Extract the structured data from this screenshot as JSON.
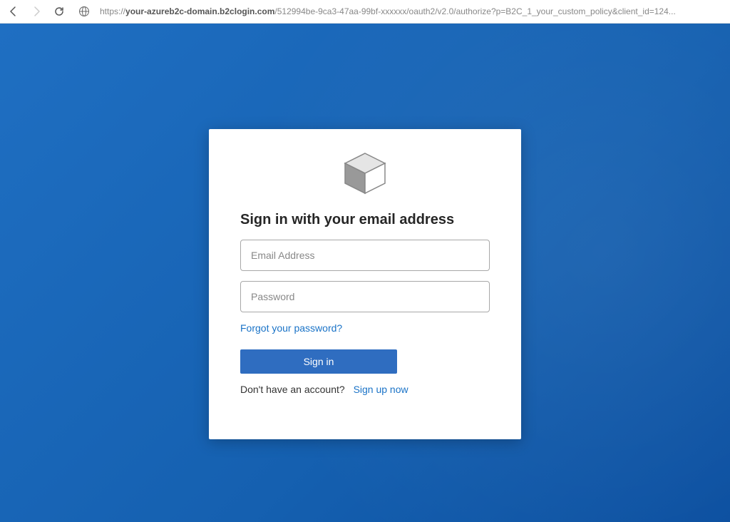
{
  "browser": {
    "url_prefix": "https://",
    "url_domain": "your-azureb2c-domain.b2clogin.com",
    "url_path": "/512994be-9ca3-47aa-99bf-xxxxxx/oauth2/v2.0/authorize?p=B2C_1_your_custom_policy&client_id=124..."
  },
  "card": {
    "title": "Sign in with your email address",
    "email_placeholder": "Email Address",
    "password_placeholder": "Password",
    "forgot_link": "Forgot your password?",
    "signin_label": "Sign in",
    "no_account_text": "Don't have an account?",
    "signup_label": "Sign up now"
  }
}
